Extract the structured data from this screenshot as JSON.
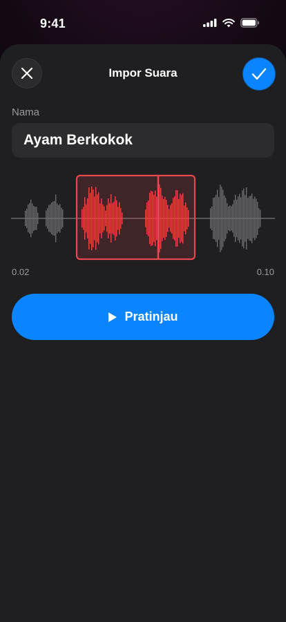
{
  "status": {
    "time": "9:41"
  },
  "header": {
    "title": "Impor Suara",
    "close_icon": "close-icon",
    "done_icon": "checkmark-icon"
  },
  "form": {
    "name_label": "Nama",
    "name_value": "Ayam Berkokok"
  },
  "waveform": {
    "start_time": "0.02",
    "end_time": "0.10",
    "selection_color": "#e5484d",
    "inactive_color": "#6b6b6e"
  },
  "preview": {
    "label": "Pratinjau",
    "icon": "play-icon"
  },
  "colors": {
    "accent": "#0a84ff",
    "sheet": "#1f1f21",
    "field": "#2c2c2e"
  }
}
